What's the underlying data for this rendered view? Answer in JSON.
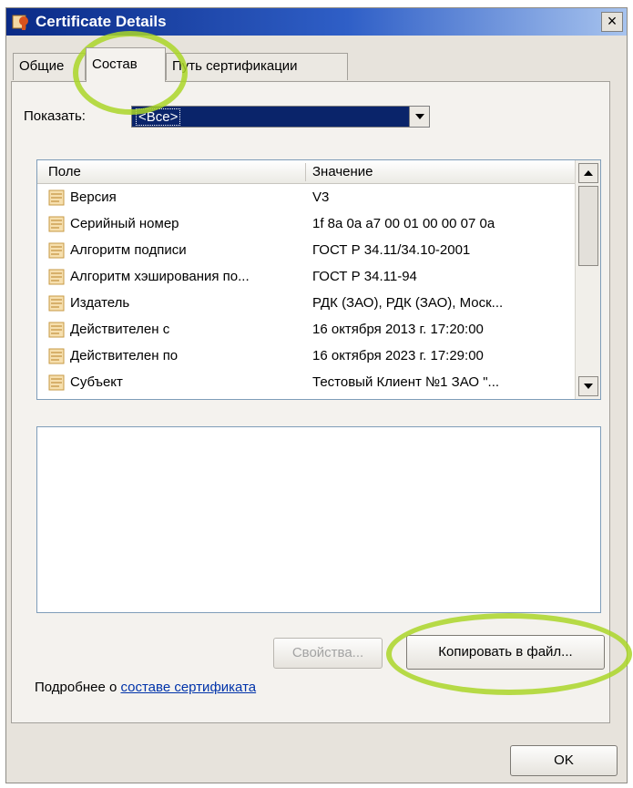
{
  "window": {
    "title": "Certificate Details",
    "close_glyph": "×"
  },
  "tabs": [
    {
      "label": "Общие"
    },
    {
      "label": "Состав"
    },
    {
      "label": "Путь сертификации"
    }
  ],
  "filter": {
    "label": "Показать:",
    "selected": "<Все>"
  },
  "list": {
    "columns": [
      "Поле",
      "Значение"
    ],
    "rows": [
      {
        "field": "Версия",
        "value": "V3"
      },
      {
        "field": "Серийный номер",
        "value": "1f 8a 0a a7 00 01 00 00 07 0a"
      },
      {
        "field": "Алгоритм подписи",
        "value": "ГОСТ Р 34.11/34.10-2001"
      },
      {
        "field": "Алгоритм хэширования по...",
        "value": "ГОСТ Р 34.11-94"
      },
      {
        "field": "Издатель",
        "value": "РДК (ЗАО), РДК (ЗАО), Моск..."
      },
      {
        "field": "Действителен с",
        "value": "16 октября 2013 г. 17:20:00"
      },
      {
        "field": "Действителен по",
        "value": "16 октября 2023 г. 17:29:00"
      },
      {
        "field": "Субъект",
        "value": "Тестовый Клиент №1 ЗАО \"..."
      }
    ]
  },
  "buttons": {
    "properties": "Свойства...",
    "copy_to_file": "Копировать в файл...",
    "ok": "OK"
  },
  "more_info": {
    "prefix": "Подробнее о ",
    "link": "составе сертификата"
  },
  "colors": {
    "title_bar": "#0a2a86",
    "selection": "#0a246a",
    "highlight": "#aad628"
  }
}
